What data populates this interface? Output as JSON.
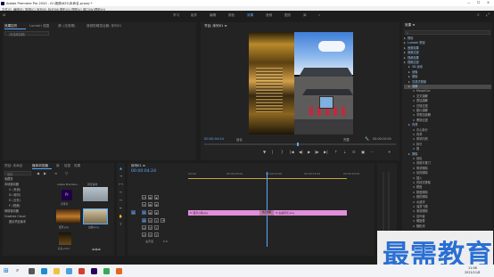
{
  "titlebar": {
    "title": "Adobe Premiere Pro 2020 - D:\\视频\\625\\未命名.prproj *",
    "min": "—",
    "max": "☐",
    "close": "✕"
  },
  "menubar": {
    "items": [
      "文件(F)",
      "编辑(E)",
      "剪辑(C)",
      "序列(S)",
      "标记(M)",
      "图形(G)",
      "视图(V)",
      "窗口(W)",
      "帮助(H)"
    ]
  },
  "workspaces": {
    "items": [
      "学习",
      "组件",
      "编辑",
      "颜色",
      "效果",
      "音频",
      "图形",
      "库"
    ],
    "active": "效果",
    "more": "»"
  },
  "source_panel": {
    "tabs": [
      "效果控件",
      "Lumetri 范围",
      "源: (无剪辑)",
      "音频剪辑混合器: 序列01"
    ],
    "active_tab": "效果控件",
    "placeholder": "（未选择剪辑）"
  },
  "program": {
    "title": "节目: 序列01 ≡",
    "timecode": "00:00:04:24",
    "fit": "适合",
    "quality": "完整",
    "duration": "00:00:10:00"
  },
  "project": {
    "tabs": [
      "项目: 未命名",
      "媒体浏览器",
      "库",
      "信息",
      "效果"
    ],
    "active_tab": "媒体浏览器",
    "search_placeholder": "搜索",
    "tree": [
      "收藏夹",
      "本地驱动器",
      "C: (系统)",
      "D: (软件)",
      "E: (文件)",
      "F: (视频)",
      "网络驱动器",
      "Creative Cloud",
      "团队项目版本"
    ],
    "items": [
      {
        "name": "Adobe Premiere...",
        "label": "宣传片"
      },
      {
        "name": "风景素材",
        "label": ""
      },
      {
        "name": "城市夜景",
        "label": "夜景.jpg"
      },
      {
        "name": "古镇.png",
        "label": "古镇.png"
      },
      {
        "name": "片头.mp4",
        "label": "片头.mp4"
      }
    ]
  },
  "timeline": {
    "tab": "序列01 ≡",
    "timecode": "00:00:04:24",
    "ticks": [
      "00:00",
      "00:00:05:00",
      "00:00:10:00",
      "00:00:15:00",
      "00:00:20:00"
    ],
    "tracks": [
      "V3",
      "V2",
      "V1",
      "A1",
      "A2",
      "A3"
    ],
    "master": "主声道",
    "master_value": "0.0",
    "clips": [
      {
        "label": "fx 夜景小镇.jpg"
      },
      {
        "label": "交叉溶解"
      },
      {
        "label": "fx 古镇风光.png"
      }
    ]
  },
  "effects": {
    "title": "效果 ≡",
    "tree": [
      {
        "t": "预设",
        "d": 0,
        "f": true
      },
      {
        "t": "Lumetri 预设",
        "d": 0,
        "f": true
      },
      {
        "t": "音频效果",
        "d": 0,
        "f": true
      },
      {
        "t": "音频过渡",
        "d": 0,
        "f": true
      },
      {
        "t": "视频效果",
        "d": 0,
        "f": true
      },
      {
        "t": "视频过渡",
        "d": 0,
        "f": true
      },
      {
        "t": "3D 运动",
        "d": 1,
        "f": true
      },
      {
        "t": "划像",
        "d": 1,
        "f": true
      },
      {
        "t": "擦除",
        "d": 1,
        "f": true
      },
      {
        "t": "沉浸式视频",
        "d": 1,
        "f": true
      },
      {
        "t": "溶解",
        "d": 1,
        "f": true,
        "hl": true
      },
      {
        "t": "MorphCut",
        "d": 2,
        "f": false
      },
      {
        "t": "交叉溶解",
        "d": 2,
        "f": false
      },
      {
        "t": "叠加溶解",
        "d": 2,
        "f": false
      },
      {
        "t": "白场过渡",
        "d": 2,
        "f": false
      },
      {
        "t": "胶片溶解",
        "d": 2,
        "f": false
      },
      {
        "t": "非叠加溶解",
        "d": 2,
        "f": false
      },
      {
        "t": "黑场过渡",
        "d": 2,
        "f": false
      },
      {
        "t": "内滑",
        "d": 1,
        "f": true
      },
      {
        "t": "中心拆分",
        "d": 2,
        "f": false
      },
      {
        "t": "内滑",
        "d": 2,
        "f": false
      },
      {
        "t": "带状内滑",
        "d": 2,
        "f": false
      },
      {
        "t": "拆分",
        "d": 2,
        "f": false
      },
      {
        "t": "推",
        "d": 2,
        "f": false
      },
      {
        "t": "擦除",
        "d": 1,
        "f": true
      },
      {
        "t": "划出",
        "d": 2,
        "f": false
      },
      {
        "t": "双侧平推门",
        "d": 2,
        "f": false
      },
      {
        "t": "带状擦除",
        "d": 2,
        "f": false
      },
      {
        "t": "径向擦除",
        "d": 2,
        "f": false
      },
      {
        "t": "插入",
        "d": 2,
        "f": false
      },
      {
        "t": "时钟式擦除",
        "d": 2,
        "f": false
      },
      {
        "t": "棋盘",
        "d": 2,
        "f": false
      },
      {
        "t": "棋盘擦除",
        "d": 2,
        "f": false
      },
      {
        "t": "楔形擦除",
        "d": 2,
        "f": false
      },
      {
        "t": "水波块",
        "d": 2,
        "f": false
      },
      {
        "t": "油漆飞溅",
        "d": 2,
        "f": false
      },
      {
        "t": "渐变擦除",
        "d": 2,
        "f": false
      },
      {
        "t": "百叶窗",
        "d": 2,
        "f": false
      },
      {
        "t": "螺旋框",
        "d": 2,
        "f": false
      },
      {
        "t": "随机块",
        "d": 2,
        "f": false
      }
    ]
  },
  "watermark": {
    "text": "最需教育"
  },
  "taskbar": {
    "search_placeholder": "在这里输入你要搜索的内容",
    "time": "11:06",
    "date": "2021/11/8"
  },
  "colors": {
    "accent": "#2d8ceb",
    "clip": "#e08fd8",
    "transition": "#b47aa6",
    "watermark": "#2a6fd3"
  }
}
